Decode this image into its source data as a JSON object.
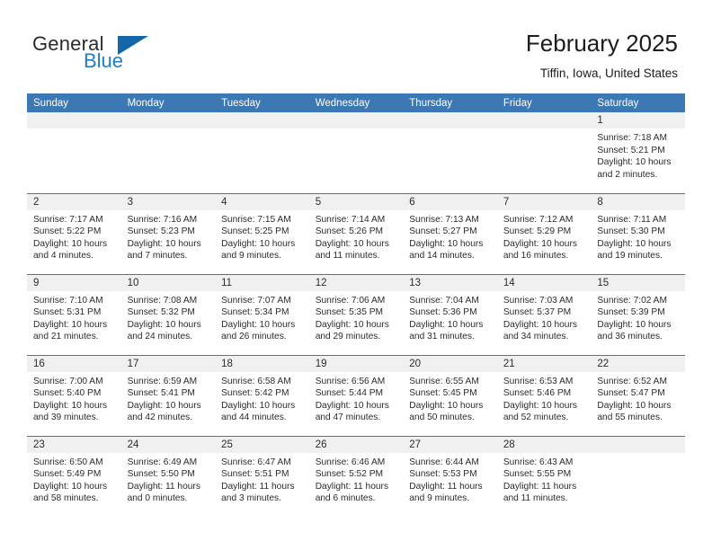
{
  "brand": {
    "name_part1": "General",
    "name_part2": "Blue",
    "accent_color": "#1366a8",
    "blue_text_color": "#1f7fc4"
  },
  "header": {
    "title": "February 2025",
    "subtitle": "Tiffin, Iowa, United States"
  },
  "theme": {
    "header_row_bg": "#3c78b4",
    "daynum_band_bg": "#f0f0f0",
    "grid_line": "#3c78b4",
    "text": "#2b2b2b"
  },
  "weekdays": [
    "Sunday",
    "Monday",
    "Tuesday",
    "Wednesday",
    "Thursday",
    "Friday",
    "Saturday"
  ],
  "weeks": [
    [
      {
        "day": "",
        "sunrise": "",
        "sunset": "",
        "daylight_line1": "",
        "daylight_line2": ""
      },
      {
        "day": "",
        "sunrise": "",
        "sunset": "",
        "daylight_line1": "",
        "daylight_line2": ""
      },
      {
        "day": "",
        "sunrise": "",
        "sunset": "",
        "daylight_line1": "",
        "daylight_line2": ""
      },
      {
        "day": "",
        "sunrise": "",
        "sunset": "",
        "daylight_line1": "",
        "daylight_line2": ""
      },
      {
        "day": "",
        "sunrise": "",
        "sunset": "",
        "daylight_line1": "",
        "daylight_line2": ""
      },
      {
        "day": "",
        "sunrise": "",
        "sunset": "",
        "daylight_line1": "",
        "daylight_line2": ""
      },
      {
        "day": "1",
        "sunrise": "Sunrise: 7:18 AM",
        "sunset": "Sunset: 5:21 PM",
        "daylight_line1": "Daylight: 10 hours",
        "daylight_line2": "and 2 minutes."
      }
    ],
    [
      {
        "day": "2",
        "sunrise": "Sunrise: 7:17 AM",
        "sunset": "Sunset: 5:22 PM",
        "daylight_line1": "Daylight: 10 hours",
        "daylight_line2": "and 4 minutes."
      },
      {
        "day": "3",
        "sunrise": "Sunrise: 7:16 AM",
        "sunset": "Sunset: 5:23 PM",
        "daylight_line1": "Daylight: 10 hours",
        "daylight_line2": "and 7 minutes."
      },
      {
        "day": "4",
        "sunrise": "Sunrise: 7:15 AM",
        "sunset": "Sunset: 5:25 PM",
        "daylight_line1": "Daylight: 10 hours",
        "daylight_line2": "and 9 minutes."
      },
      {
        "day": "5",
        "sunrise": "Sunrise: 7:14 AM",
        "sunset": "Sunset: 5:26 PM",
        "daylight_line1": "Daylight: 10 hours",
        "daylight_line2": "and 11 minutes."
      },
      {
        "day": "6",
        "sunrise": "Sunrise: 7:13 AM",
        "sunset": "Sunset: 5:27 PM",
        "daylight_line1": "Daylight: 10 hours",
        "daylight_line2": "and 14 minutes."
      },
      {
        "day": "7",
        "sunrise": "Sunrise: 7:12 AM",
        "sunset": "Sunset: 5:29 PM",
        "daylight_line1": "Daylight: 10 hours",
        "daylight_line2": "and 16 minutes."
      },
      {
        "day": "8",
        "sunrise": "Sunrise: 7:11 AM",
        "sunset": "Sunset: 5:30 PM",
        "daylight_line1": "Daylight: 10 hours",
        "daylight_line2": "and 19 minutes."
      }
    ],
    [
      {
        "day": "9",
        "sunrise": "Sunrise: 7:10 AM",
        "sunset": "Sunset: 5:31 PM",
        "daylight_line1": "Daylight: 10 hours",
        "daylight_line2": "and 21 minutes."
      },
      {
        "day": "10",
        "sunrise": "Sunrise: 7:08 AM",
        "sunset": "Sunset: 5:32 PM",
        "daylight_line1": "Daylight: 10 hours",
        "daylight_line2": "and 24 minutes."
      },
      {
        "day": "11",
        "sunrise": "Sunrise: 7:07 AM",
        "sunset": "Sunset: 5:34 PM",
        "daylight_line1": "Daylight: 10 hours",
        "daylight_line2": "and 26 minutes."
      },
      {
        "day": "12",
        "sunrise": "Sunrise: 7:06 AM",
        "sunset": "Sunset: 5:35 PM",
        "daylight_line1": "Daylight: 10 hours",
        "daylight_line2": "and 29 minutes."
      },
      {
        "day": "13",
        "sunrise": "Sunrise: 7:04 AM",
        "sunset": "Sunset: 5:36 PM",
        "daylight_line1": "Daylight: 10 hours",
        "daylight_line2": "and 31 minutes."
      },
      {
        "day": "14",
        "sunrise": "Sunrise: 7:03 AM",
        "sunset": "Sunset: 5:37 PM",
        "daylight_line1": "Daylight: 10 hours",
        "daylight_line2": "and 34 minutes."
      },
      {
        "day": "15",
        "sunrise": "Sunrise: 7:02 AM",
        "sunset": "Sunset: 5:39 PM",
        "daylight_line1": "Daylight: 10 hours",
        "daylight_line2": "and 36 minutes."
      }
    ],
    [
      {
        "day": "16",
        "sunrise": "Sunrise: 7:00 AM",
        "sunset": "Sunset: 5:40 PM",
        "daylight_line1": "Daylight: 10 hours",
        "daylight_line2": "and 39 minutes."
      },
      {
        "day": "17",
        "sunrise": "Sunrise: 6:59 AM",
        "sunset": "Sunset: 5:41 PM",
        "daylight_line1": "Daylight: 10 hours",
        "daylight_line2": "and 42 minutes."
      },
      {
        "day": "18",
        "sunrise": "Sunrise: 6:58 AM",
        "sunset": "Sunset: 5:42 PM",
        "daylight_line1": "Daylight: 10 hours",
        "daylight_line2": "and 44 minutes."
      },
      {
        "day": "19",
        "sunrise": "Sunrise: 6:56 AM",
        "sunset": "Sunset: 5:44 PM",
        "daylight_line1": "Daylight: 10 hours",
        "daylight_line2": "and 47 minutes."
      },
      {
        "day": "20",
        "sunrise": "Sunrise: 6:55 AM",
        "sunset": "Sunset: 5:45 PM",
        "daylight_line1": "Daylight: 10 hours",
        "daylight_line2": "and 50 minutes."
      },
      {
        "day": "21",
        "sunrise": "Sunrise: 6:53 AM",
        "sunset": "Sunset: 5:46 PM",
        "daylight_line1": "Daylight: 10 hours",
        "daylight_line2": "and 52 minutes."
      },
      {
        "day": "22",
        "sunrise": "Sunrise: 6:52 AM",
        "sunset": "Sunset: 5:47 PM",
        "daylight_line1": "Daylight: 10 hours",
        "daylight_line2": "and 55 minutes."
      }
    ],
    [
      {
        "day": "23",
        "sunrise": "Sunrise: 6:50 AM",
        "sunset": "Sunset: 5:49 PM",
        "daylight_line1": "Daylight: 10 hours",
        "daylight_line2": "and 58 minutes."
      },
      {
        "day": "24",
        "sunrise": "Sunrise: 6:49 AM",
        "sunset": "Sunset: 5:50 PM",
        "daylight_line1": "Daylight: 11 hours",
        "daylight_line2": "and 0 minutes."
      },
      {
        "day": "25",
        "sunrise": "Sunrise: 6:47 AM",
        "sunset": "Sunset: 5:51 PM",
        "daylight_line1": "Daylight: 11 hours",
        "daylight_line2": "and 3 minutes."
      },
      {
        "day": "26",
        "sunrise": "Sunrise: 6:46 AM",
        "sunset": "Sunset: 5:52 PM",
        "daylight_line1": "Daylight: 11 hours",
        "daylight_line2": "and 6 minutes."
      },
      {
        "day": "27",
        "sunrise": "Sunrise: 6:44 AM",
        "sunset": "Sunset: 5:53 PM",
        "daylight_line1": "Daylight: 11 hours",
        "daylight_line2": "and 9 minutes."
      },
      {
        "day": "28",
        "sunrise": "Sunrise: 6:43 AM",
        "sunset": "Sunset: 5:55 PM",
        "daylight_line1": "Daylight: 11 hours",
        "daylight_line2": "and 11 minutes."
      },
      {
        "day": "",
        "sunrise": "",
        "sunset": "",
        "daylight_line1": "",
        "daylight_line2": ""
      }
    ]
  ]
}
